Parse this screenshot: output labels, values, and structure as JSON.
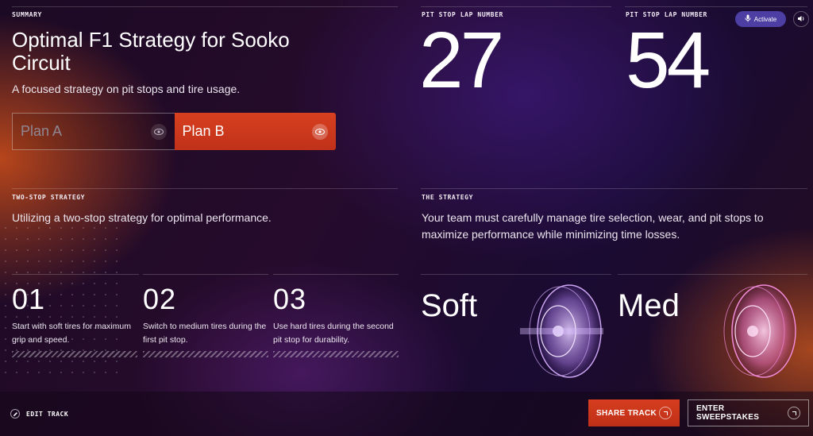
{
  "summary": {
    "label": "SUMMARY",
    "title": "Optimal F1 Strategy for Sooko Circuit",
    "subtitle": "A focused strategy on pit stops and tire usage.",
    "plans": [
      {
        "label": "Plan A",
        "selected": false
      },
      {
        "label": "Plan B",
        "selected": true
      }
    ]
  },
  "pit_stops": [
    {
      "label": "PIT STOP LAP NUMBER",
      "value": "27"
    },
    {
      "label": "PIT STOP LAP NUMBER",
      "value": "54"
    }
  ],
  "activate": {
    "label": "Activate"
  },
  "two_stop": {
    "label": "TWO-STOP STRATEGY",
    "description": "Utilizing a two-stop strategy for optimal performance.",
    "steps": [
      {
        "number": "01",
        "text": "Start with soft tires for maximum grip and speed."
      },
      {
        "number": "02",
        "text": "Switch to medium tires during the first pit stop."
      },
      {
        "number": "03",
        "text": "Use hard tires during the second pit stop for durability."
      }
    ]
  },
  "strategy": {
    "label": "THE STRATEGY",
    "description": "Your team must carefully manage tire selection, wear, and pit stops to maximize performance while minimizing time losses.",
    "tires": [
      {
        "label": "Soft",
        "color": "#c9a2f0"
      },
      {
        "label": "Med",
        "color": "#f08ad8"
      }
    ]
  },
  "footer": {
    "edit_label": "EDIT TRACK",
    "share_label": "SHARE TRACK",
    "enter_label": "ENTER SWEEPSTAKES"
  },
  "colors": {
    "accent": "#d0391b",
    "activate": "#4c3ea3"
  }
}
